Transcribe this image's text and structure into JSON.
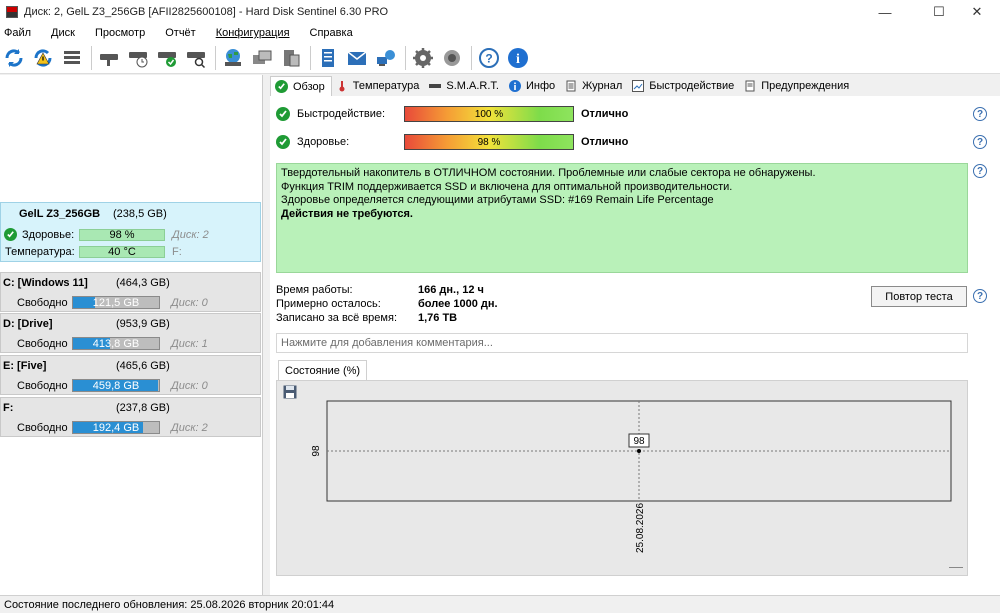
{
  "window": {
    "title": "Диск: 2, GelL Z3_256GB [AFII2825600108]  -  Hard Disk Sentinel 6.30 PRO",
    "minimize": "—",
    "maximize": "☐",
    "close": "✕"
  },
  "menu": [
    "Файл",
    "Диск",
    "Просмотр",
    "Отчёт",
    "Конфигурация",
    "Справка"
  ],
  "toolbar_icons": [
    "refresh-icon",
    "refresh-warning-icon",
    "disk-list-icon",
    "disk-info-icon",
    "disk-schedule-icon",
    "disk-check-icon",
    "disk-search-icon",
    "globe-icon",
    "hdd-copy-icon",
    "hdd-stack-icon",
    "notes-icon",
    "mail-icon",
    "network-icon",
    "settings-icon",
    "sound-icon",
    "help-icon",
    "info-icon"
  ],
  "disk": {
    "name": "GelL Z3_256GB",
    "size": "(238,5 GB)",
    "health_label": "Здоровье:",
    "health_value": "98 %",
    "disk_no": "Диск: 2",
    "temp_label": "Температура:",
    "temp_value": "40 °C",
    "drive_letter": "F:"
  },
  "partitions": [
    {
      "title": "C: [Windows 11]",
      "size": "(464,3 GB)",
      "free_label": "Свободно",
      "free": "121,5 GB",
      "free_fraction": 0.26,
      "disk": "Диск: 0"
    },
    {
      "title": "D: [Drive]",
      "size": "(953,9 GB)",
      "free_label": "Свободно",
      "free": "413,8 GB",
      "free_fraction": 0.43,
      "disk": "Диск: 1"
    },
    {
      "title": "E: [Five]",
      "size": "(465,6 GB)",
      "free_label": "Свободно",
      "free": "459,8 GB",
      "free_fraction": 0.99,
      "disk": "Диск: 0"
    },
    {
      "title": "F:",
      "size": "(237,8 GB)",
      "free_label": "Свободно",
      "free": "192,4 GB",
      "free_fraction": 0.81,
      "disk": "Диск: 2"
    }
  ],
  "tabs": [
    "Обзор",
    "Температура",
    "S.M.A.R.T.",
    "Инфо",
    "Журнал",
    "Быстродействие",
    "Предупреждения"
  ],
  "overview": {
    "performance_label": "Быстродействие:",
    "performance_value": "100 %",
    "performance_fraction": 1.0,
    "performance_verdict": "Отлично",
    "health_label": "Здоровье:",
    "health_value": "98 %",
    "health_fraction": 0.98,
    "health_verdict": "Отлично",
    "status_lines": [
      "Твердотельный накопитель в ОТЛИЧНОМ состоянии. Проблемные или слабые сектора не обнаружены.",
      "Функция TRIM поддерживается SSD и включена для оптимальной производительности.",
      "Здоровье определяется следующими атрибутами SSD: #169 Remain Life Percentage"
    ],
    "status_action": "Действия не требуются.",
    "uptime_label": "Время работы:",
    "uptime_value": "166 дн., 12 ч",
    "remaining_label": "Примерно осталось:",
    "remaining_value": "более 1000 дн.",
    "written_label": "Записано за всё время:",
    "written_value": "1,76 TB",
    "retest_button": "Повтор теста",
    "comment_placeholder": "Нажмите для добавления комментария..."
  },
  "chart_tab": "Состояние (%)",
  "chart_data": {
    "type": "line",
    "x": [
      "25.08.2026"
    ],
    "y": [
      98
    ],
    "series": [
      {
        "values": [
          98
        ]
      }
    ],
    "ytick": "98",
    "xtick": "25.08.2026",
    "point_label": "98",
    "grid": true
  },
  "statusbar": "Состояние последнего обновления: 25.08.2026 вторник 20:01:44"
}
